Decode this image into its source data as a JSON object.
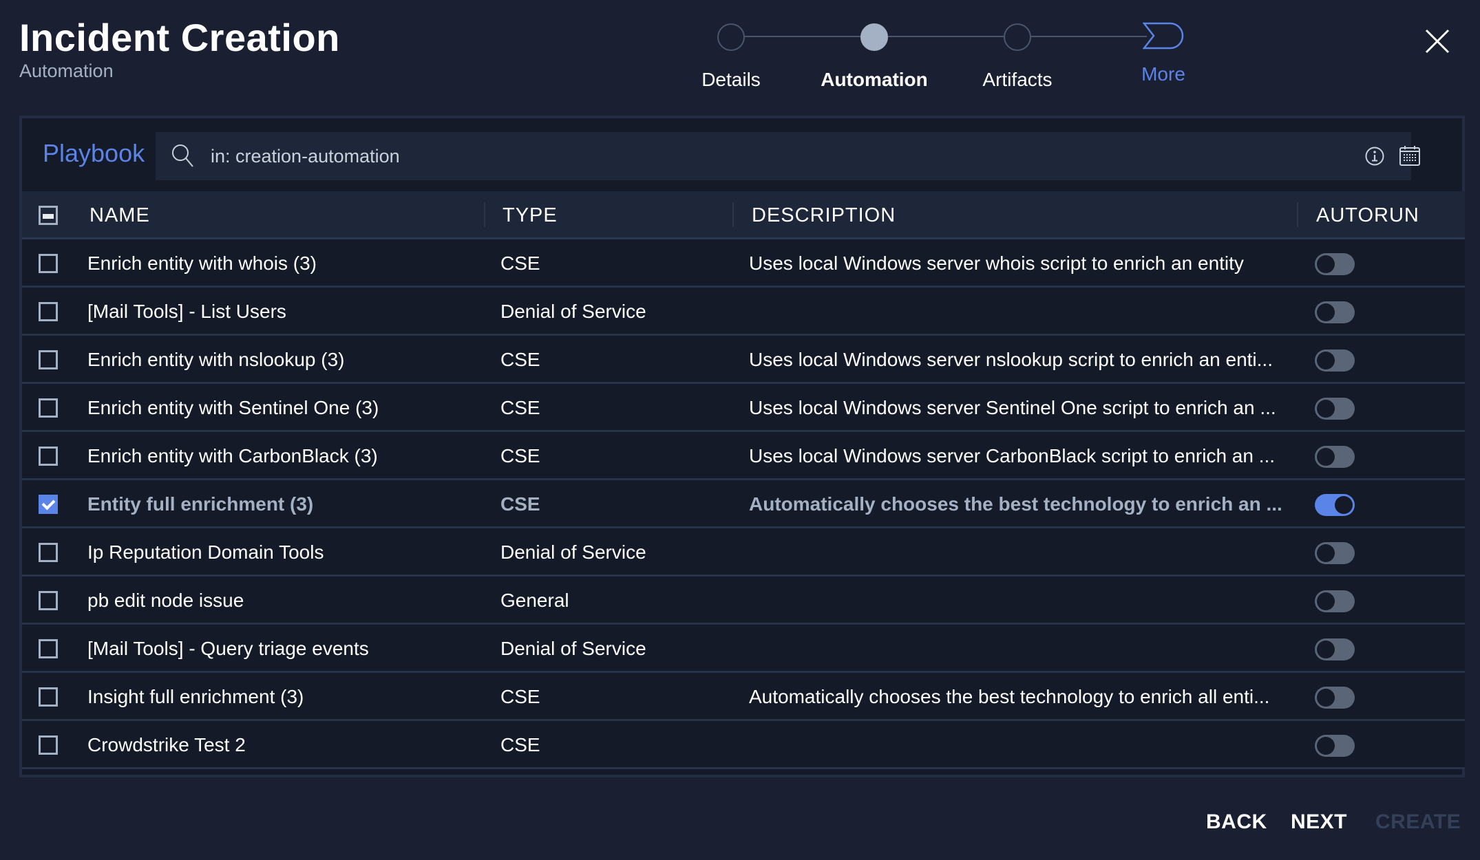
{
  "header": {
    "title": "Incident Creation",
    "subtitle": "Automation"
  },
  "stepper": {
    "steps": [
      {
        "label": "Details",
        "state": "incomplete"
      },
      {
        "label": "Automation",
        "state": "active"
      },
      {
        "label": "Artifacts",
        "state": "incomplete"
      }
    ],
    "more_label": "More"
  },
  "search": {
    "label": "Playbook",
    "value": "in: creation-automation",
    "placeholder": ""
  },
  "table": {
    "columns": [
      "NAME",
      "TYPE",
      "DESCRIPTION",
      "AUTORUN"
    ],
    "select_all_state": "indeterminate",
    "rows": [
      {
        "name": "Enrich entity with whois (3)",
        "type": "CSE",
        "description": "Uses local Windows server whois script to enrich an entity",
        "selected": false,
        "autorun": false
      },
      {
        "name": "[Mail Tools] - List Users",
        "type": "Denial of Service",
        "description": "",
        "selected": false,
        "autorun": false
      },
      {
        "name": "Enrich entity with nslookup (3)",
        "type": "CSE",
        "description": "Uses local Windows server nslookup script to enrich an enti...",
        "selected": false,
        "autorun": false
      },
      {
        "name": "Enrich entity with Sentinel One (3)",
        "type": "CSE",
        "description": "Uses local Windows server Sentinel One script to enrich an ...",
        "selected": false,
        "autorun": false
      },
      {
        "name": "Enrich entity with CarbonBlack (3)",
        "type": "CSE",
        "description": "Uses local Windows server CarbonBlack script to enrich an ...",
        "selected": false,
        "autorun": false
      },
      {
        "name": "Entity full enrichment (3)",
        "type": "CSE",
        "description": "Automatically chooses the best technology to enrich an ...",
        "selected": true,
        "autorun": true
      },
      {
        "name": "Ip Reputation Domain Tools",
        "type": "Denial of Service",
        "description": "",
        "selected": false,
        "autorun": false
      },
      {
        "name": "pb edit node issue",
        "type": "General",
        "description": "",
        "selected": false,
        "autorun": false
      },
      {
        "name": "[Mail Tools] - Query triage events",
        "type": "Denial of Service",
        "description": "",
        "selected": false,
        "autorun": false
      },
      {
        "name": "Insight full enrichment (3)",
        "type": "CSE",
        "description": "Automatically chooses the best technology to enrich all enti...",
        "selected": false,
        "autorun": false
      },
      {
        "name": "Crowdstrike Test 2",
        "type": "CSE",
        "description": "",
        "selected": false,
        "autorun": false
      }
    ]
  },
  "footer": {
    "back_label": "BACK",
    "next_label": "NEXT",
    "create_label": "CREATE",
    "create_disabled": true
  },
  "colors": {
    "background": "#1a2032",
    "panel": "#141a27",
    "accent": "#5b84e8",
    "muted": "#a4b1c4",
    "toggle_off": "#5a6677",
    "disabled": "#34405a"
  }
}
